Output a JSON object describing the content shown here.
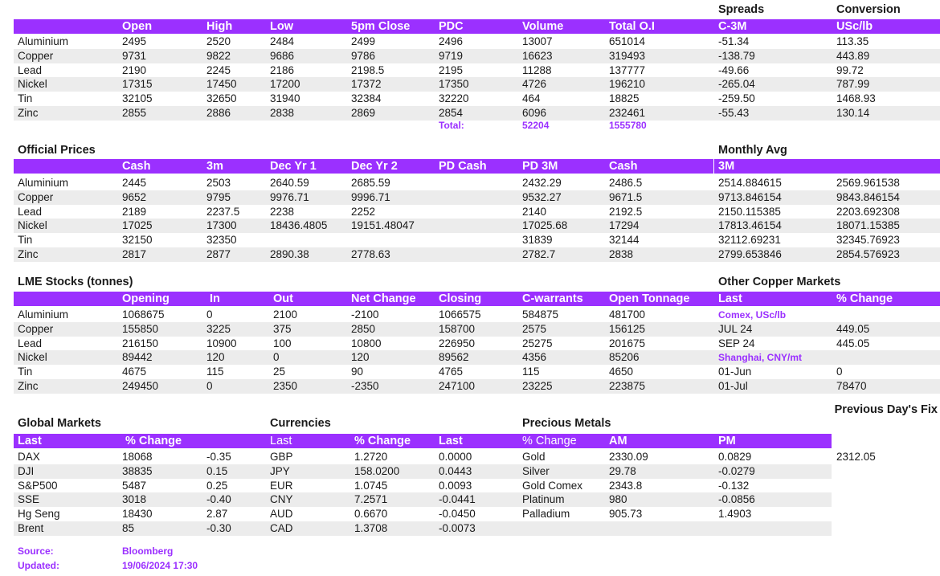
{
  "accent_color": "#9b30ff",
  "sec1": {
    "super": [
      "Spreads",
      "Conversion"
    ],
    "headers": [
      "Open",
      "High",
      "Low",
      "5pm Close",
      "PDC",
      "Volume",
      "Total O.I",
      "C-3M",
      "USc/lb"
    ],
    "rows": [
      [
        "Aluminium",
        "2495",
        "2520",
        "2484",
        "2499",
        "2496",
        "13007",
        "651014",
        "-51.34",
        "113.35"
      ],
      [
        "Copper",
        "9731",
        "9822",
        "9686",
        "9786",
        "9719",
        "16623",
        "319493",
        "-138.79",
        "443.89"
      ],
      [
        "Lead",
        "2190",
        "2245",
        "2186",
        "2198.5",
        "2195",
        "11288",
        "137777",
        "-49.66",
        "99.72"
      ],
      [
        "Nickel",
        "17315",
        "17450",
        "17200",
        "17372",
        "17350",
        "4726",
        "196210",
        "-265.04",
        "787.99"
      ],
      [
        "Tin",
        "32105",
        "32650",
        "31940",
        "32384",
        "32220",
        "464",
        "18825",
        "-259.50",
        "1468.93"
      ],
      [
        "Zinc",
        "2855",
        "2886",
        "2838",
        "2869",
        "2854",
        "6096",
        "232461",
        "-55.43",
        "130.14"
      ]
    ],
    "total_label": "Total:",
    "total_volume": "52204",
    "total_oi": "1555780"
  },
  "sec2": {
    "title": "Official Prices",
    "super": "Monthly Avg",
    "headers": [
      "Cash",
      "3m",
      "Dec Yr 1",
      "Dec Yr 2",
      "PD Cash",
      "PD 3M",
      "Cash",
      "3M"
    ],
    "rows": [
      [
        "Aluminium",
        "2445",
        "2503",
        "2640.59",
        "2685.59",
        "",
        "2432.29",
        "2486.5",
        "2514.884615",
        "2569.961538"
      ],
      [
        "Copper",
        "9652",
        "9795",
        "9976.71",
        "9996.71",
        "",
        "9532.27",
        "9671.5",
        "9713.846154",
        "9843.846154"
      ],
      [
        "Lead",
        "2189",
        "2237.5",
        "2238",
        "2252",
        "",
        "2140",
        "2192.5",
        "2150.115385",
        "2203.692308"
      ],
      [
        "Nickel",
        "17025",
        "17300",
        "18436.4805",
        "19151.48047",
        "",
        "17025.68",
        "17294",
        "17813.46154",
        "18071.15385"
      ],
      [
        "Tin",
        "32150",
        "32350",
        "",
        "",
        "",
        "31839",
        "32144",
        "32112.69231",
        "32345.76923"
      ],
      [
        "Zinc",
        "2817",
        "2877",
        "2890.38",
        "2778.63",
        "",
        "2782.7",
        "2838",
        "2799.653846",
        "2854.576923"
      ]
    ]
  },
  "sec3": {
    "title": "LME Stocks (tonnes)",
    "super": "Other Copper Markets",
    "headers": [
      "Opening",
      "In",
      "Out",
      "Net Change",
      "Closing",
      "C-warrants",
      "Open Tonnage",
      "Last",
      "% Change"
    ],
    "rows": [
      [
        "Aluminium",
        "1068675",
        "0",
        "2100",
        "-2100",
        "1066575",
        "584875",
        "481700",
        "Comex, USc/lb",
        ""
      ],
      [
        "Copper",
        "155850",
        "3225",
        "375",
        "2850",
        "158700",
        "2575",
        "156125",
        "JUL 24",
        "449.05"
      ],
      [
        "Lead",
        "216150",
        "10900",
        "100",
        "10800",
        "226950",
        "25275",
        "201675",
        "SEP 24",
        "445.05"
      ],
      [
        "Nickel",
        "89442",
        "120",
        "0",
        "120",
        "89562",
        "4356",
        "85206",
        "Shanghai, CNY/mt",
        ""
      ],
      [
        "Tin",
        "4675",
        "115",
        "25",
        "90",
        "4765",
        "115",
        "4650",
        "01-Jun",
        "0"
      ],
      [
        "Zinc",
        "249450",
        "0",
        "2350",
        "-2350",
        "247100",
        "23225",
        "223875",
        "01-Jul",
        "78470"
      ]
    ]
  },
  "sec4": {
    "titles": [
      "Global Markets",
      "Currencies",
      "Precious Metals"
    ],
    "prev_fix": "Previous Day's Fix",
    "headers": [
      "Last",
      "% Change",
      "Last",
      "% Change",
      "Last",
      "% Change",
      "AM",
      "PM"
    ],
    "rows": [
      [
        "DAX",
        "18068",
        "-0.35",
        "GBP",
        "1.2720",
        "0.0000",
        "Gold",
        "2330.09",
        "0.0829",
        "2312.05"
      ],
      [
        "DJI",
        "38835",
        "0.15",
        "JPY",
        "158.0200",
        "0.0443",
        "Silver",
        "29.78",
        "-0.0279",
        ""
      ],
      [
        "S&P500",
        "5487",
        "0.25",
        "EUR",
        "1.0745",
        "0.0093",
        "Gold Comex",
        "2343.8",
        "-0.132",
        ""
      ],
      [
        "SSE",
        "3018",
        "-0.40",
        "CNY",
        "7.2571",
        "-0.0441",
        "Platinum",
        "980",
        "-0.0856",
        ""
      ],
      [
        "Hg Seng",
        "18430",
        "2.87",
        "AUD",
        "0.6670",
        "-0.0450",
        "Palladium",
        "905.73",
        "1.4903",
        ""
      ],
      [
        "Brent",
        "85",
        "-0.30",
        "CAD",
        "1.3708",
        "-0.0073",
        "",
        "",
        "",
        ""
      ]
    ]
  },
  "footer": {
    "source_label": "Source:",
    "source_value": "Bloomberg",
    "updated_label": "Updated:",
    "updated_value": "19/06/2024 17:30"
  }
}
